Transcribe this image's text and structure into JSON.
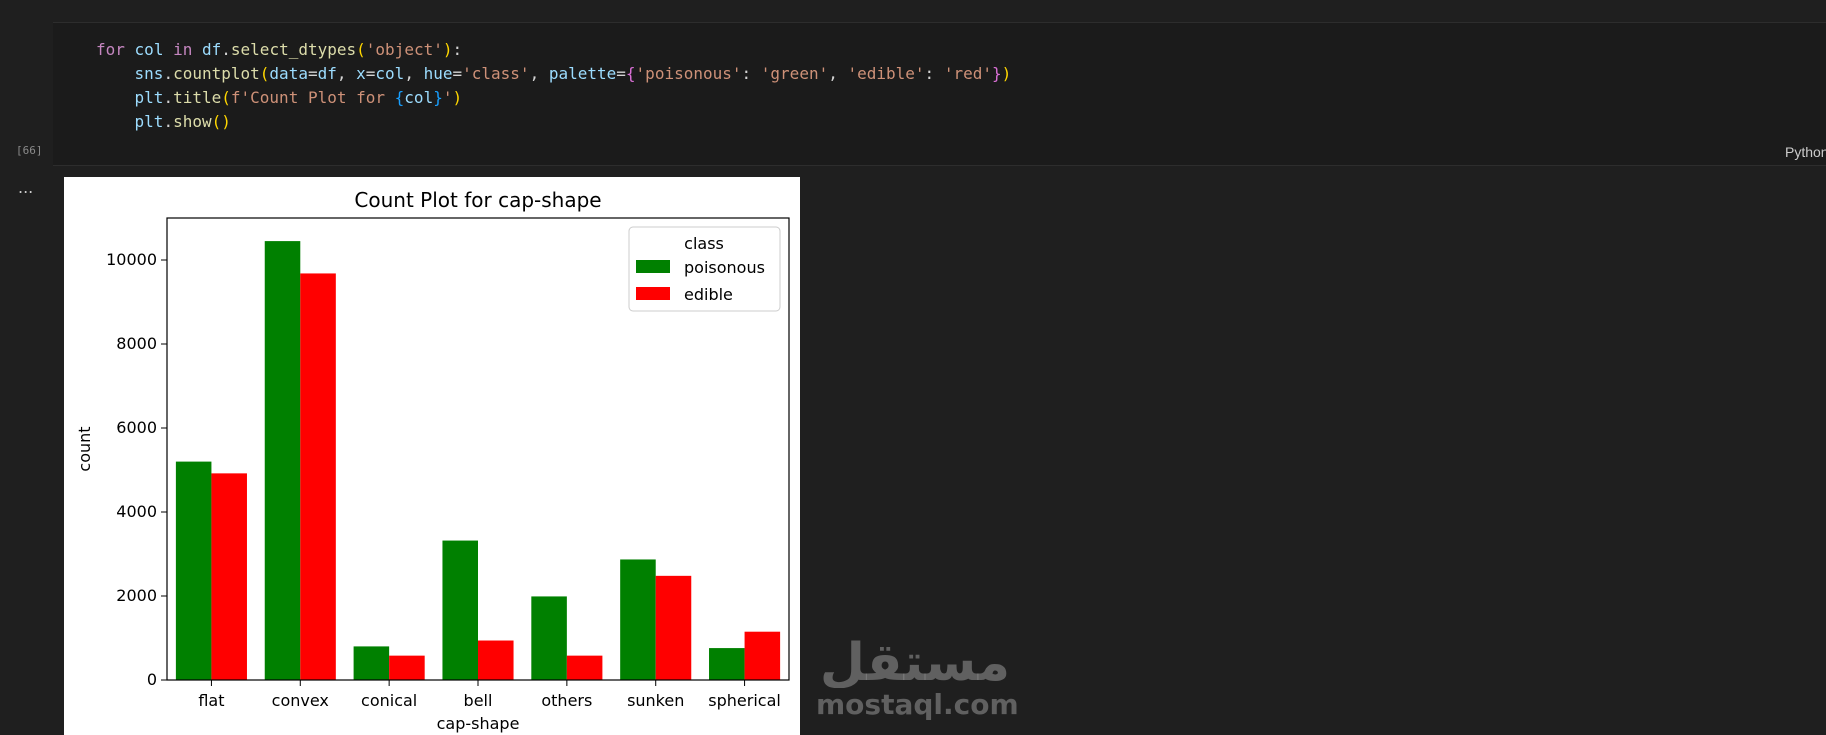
{
  "cell": {
    "execution_count": "[66]",
    "language": "Python",
    "code_lines": [
      [
        {
          "t": "for",
          "c": "kw"
        },
        {
          "t": " ",
          "c": ""
        },
        {
          "t": "col",
          "c": "var"
        },
        {
          "t": " ",
          "c": ""
        },
        {
          "t": "in",
          "c": "kw"
        },
        {
          "t": " ",
          "c": ""
        },
        {
          "t": "df",
          "c": "var"
        },
        {
          "t": ".",
          "c": ""
        },
        {
          "t": "select_dtypes",
          "c": "fn"
        },
        {
          "t": "(",
          "c": "p1"
        },
        {
          "t": "'object'",
          "c": "str"
        },
        {
          "t": ")",
          "c": "p1"
        },
        {
          "t": ":",
          "c": ""
        }
      ],
      [
        {
          "t": "    ",
          "c": ""
        },
        {
          "t": "sns",
          "c": "var"
        },
        {
          "t": ".",
          "c": ""
        },
        {
          "t": "countplot",
          "c": "fn"
        },
        {
          "t": "(",
          "c": "p1"
        },
        {
          "t": "data",
          "c": "var"
        },
        {
          "t": "=",
          "c": ""
        },
        {
          "t": "df",
          "c": "var"
        },
        {
          "t": ", ",
          "c": ""
        },
        {
          "t": "x",
          "c": "var"
        },
        {
          "t": "=",
          "c": ""
        },
        {
          "t": "col",
          "c": "var"
        },
        {
          "t": ", ",
          "c": ""
        },
        {
          "t": "hue",
          "c": "var"
        },
        {
          "t": "=",
          "c": ""
        },
        {
          "t": "'class'",
          "c": "str"
        },
        {
          "t": ", ",
          "c": ""
        },
        {
          "t": "palette",
          "c": "var"
        },
        {
          "t": "=",
          "c": ""
        },
        {
          "t": "{",
          "c": "p2"
        },
        {
          "t": "'poisonous'",
          "c": "str"
        },
        {
          "t": ": ",
          "c": ""
        },
        {
          "t": "'green'",
          "c": "str"
        },
        {
          "t": ", ",
          "c": ""
        },
        {
          "t": "'edible'",
          "c": "str"
        },
        {
          "t": ": ",
          "c": ""
        },
        {
          "t": "'red'",
          "c": "str"
        },
        {
          "t": "}",
          "c": "p2"
        },
        {
          "t": ")",
          "c": "p1"
        }
      ],
      [
        {
          "t": "    ",
          "c": ""
        },
        {
          "t": "plt",
          "c": "var"
        },
        {
          "t": ".",
          "c": ""
        },
        {
          "t": "title",
          "c": "fn"
        },
        {
          "t": "(",
          "c": "p1"
        },
        {
          "t": "f'Count Plot for ",
          "c": "str"
        },
        {
          "t": "{",
          "c": "p3"
        },
        {
          "t": "col",
          "c": "var"
        },
        {
          "t": "}",
          "c": "p3"
        },
        {
          "t": "'",
          "c": "str"
        },
        {
          "t": ")",
          "c": "p1"
        }
      ],
      [
        {
          "t": "    ",
          "c": ""
        },
        {
          "t": "plt",
          "c": "var"
        },
        {
          "t": ".",
          "c": ""
        },
        {
          "t": "show",
          "c": "fn"
        },
        {
          "t": "()",
          "c": "p1"
        }
      ]
    ]
  },
  "output": {
    "ellipsis": "...",
    "watermark_arabic": "مستقل",
    "watermark_latin": "mostaql.com"
  },
  "chart_data": {
    "type": "bar",
    "title": "Count Plot for cap-shape",
    "xlabel": "cap-shape",
    "ylabel": "count",
    "ylim": [
      0,
      11000
    ],
    "yticks": [
      0,
      2000,
      4000,
      6000,
      8000,
      10000
    ],
    "categories": [
      "flat",
      "convex",
      "conical",
      "bell",
      "others",
      "sunken",
      "spherical"
    ],
    "legend": {
      "title": "class",
      "placement": "top-right"
    },
    "series": [
      {
        "name": "poisonous",
        "color": "#008000",
        "values": [
          5200,
          10450,
          800,
          3320,
          1990,
          2870,
          760
        ]
      },
      {
        "name": "edible",
        "color": "#ff0000",
        "values": [
          4920,
          9680,
          580,
          940,
          580,
          2480,
          1150
        ]
      }
    ]
  }
}
